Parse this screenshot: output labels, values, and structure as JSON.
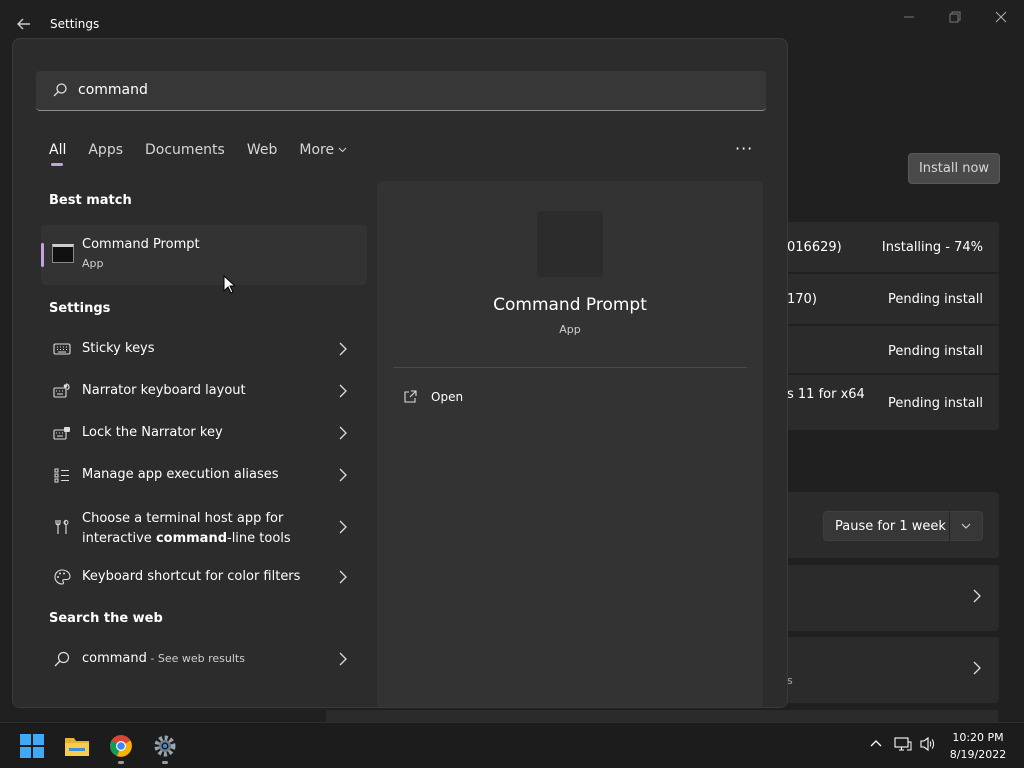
{
  "window": {
    "title": "Settings",
    "install_button": "Install now"
  },
  "updates": [
    {
      "name": "016629)",
      "status": "Installing - 74%"
    },
    {
      "name": "170)",
      "status": "Pending install"
    },
    {
      "name": "",
      "status": "Pending install"
    },
    {
      "name": "s 11 for x64",
      "status": "Pending install"
    }
  ],
  "pause": {
    "label": "Pause for 1 week"
  },
  "nav_fragment": "s",
  "search": {
    "query": "command",
    "placeholder": ""
  },
  "tabs": [
    {
      "label": "All"
    },
    {
      "label": "Apps"
    },
    {
      "label": "Documents"
    },
    {
      "label": "Web"
    },
    {
      "label": "More"
    }
  ],
  "more_dots": "···",
  "sections": {
    "best_match": "Best match",
    "settings": "Settings",
    "search_web": "Search the web"
  },
  "best_match": {
    "title": "Command Prompt",
    "subtitle": "App"
  },
  "settings_items": [
    {
      "label": "Sticky keys",
      "icon": "keyboard-icon"
    },
    {
      "label": "Narrator keyboard layout",
      "icon": "narrator-icon"
    },
    {
      "label": "Lock the Narrator key",
      "icon": "narrator-lock-icon"
    },
    {
      "label": "Manage app execution aliases",
      "icon": "list-icon"
    },
    {
      "label_pre": "Choose a terminal host app for interactive ",
      "label_bold": "command",
      "label_post": "-line tools",
      "icon": "tools-icon"
    },
    {
      "label": "Keyboard shortcut for color filters",
      "icon": "color-filter-icon"
    }
  ],
  "web_result": {
    "query": "command",
    "suffix": " - See web results"
  },
  "preview": {
    "title": "Command Prompt",
    "subtitle": "App",
    "action": "Open"
  },
  "clock": {
    "time": "10:20 PM",
    "date": "8/19/2022"
  },
  "colors": {
    "accent": "#c8a2e0",
    "background": "#202020",
    "panel": "#2c2c2c"
  }
}
